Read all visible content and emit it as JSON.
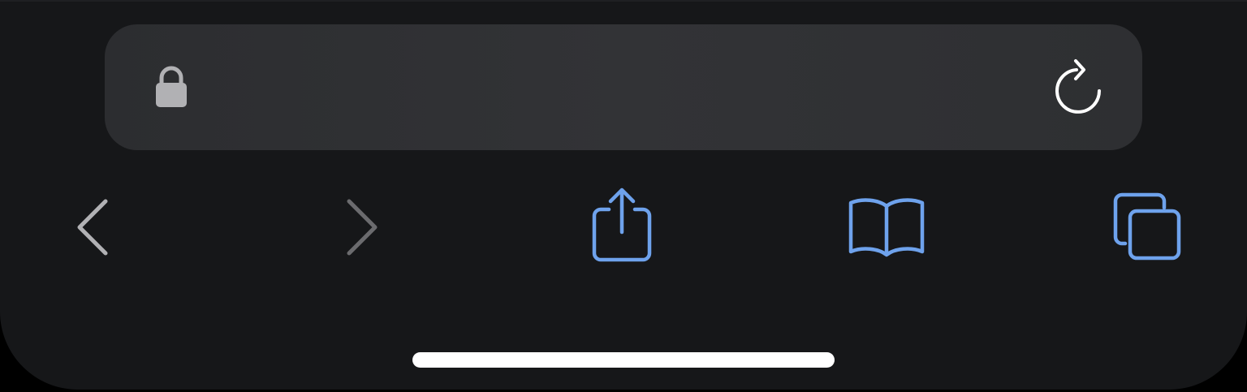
{
  "address_bar": {
    "url": "",
    "lock_icon": "lock-icon",
    "reload_icon": "reload-icon"
  },
  "toolbar": {
    "items": [
      {
        "name": "back",
        "icon": "chevron-left-icon",
        "enabled": true
      },
      {
        "name": "forward",
        "icon": "chevron-right-icon",
        "enabled": false
      },
      {
        "name": "share",
        "icon": "share-icon",
        "enabled": true
      },
      {
        "name": "bookmarks",
        "icon": "book-icon",
        "enabled": true
      },
      {
        "name": "tabs",
        "icon": "tabs-icon",
        "enabled": true
      }
    ]
  },
  "colors": {
    "background": "#161719",
    "address_bar": "#303134",
    "accent": "#6ea2ec",
    "icon_gray": "#b1b1b4",
    "icon_disabled": "#6b6b6e",
    "home_indicator": "#ffffff"
  }
}
